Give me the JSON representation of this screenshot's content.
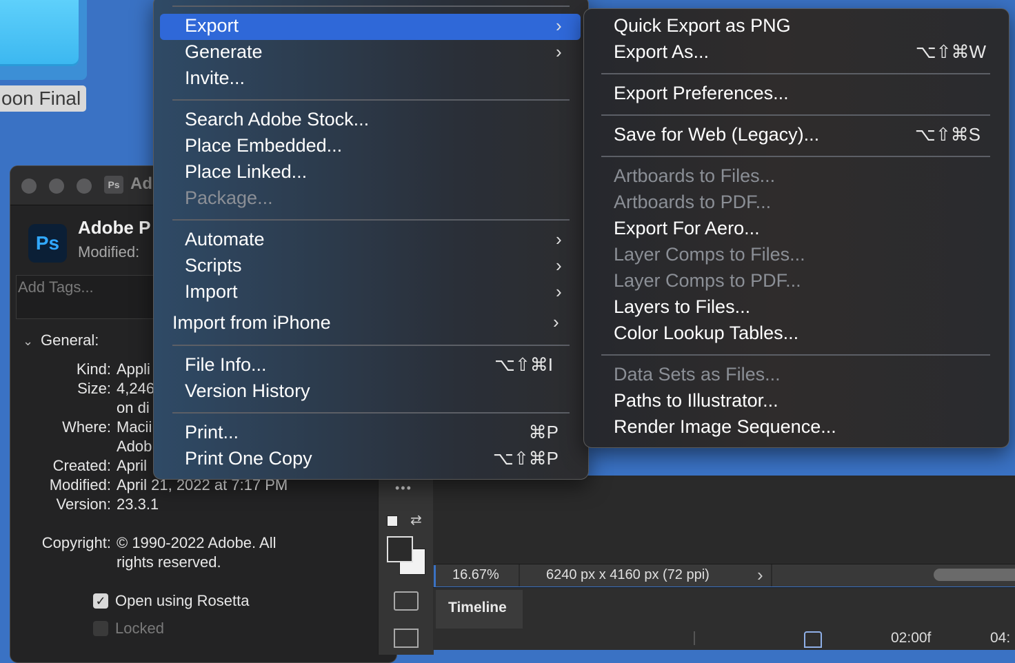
{
  "desktop": {
    "folder_label": "oon Final"
  },
  "info_window": {
    "title": "Ad",
    "ps_small": "Ps",
    "ps_big": "Ps",
    "app_name": "Adobe P",
    "modified_label": "Modified:",
    "tags_placeholder": "Add Tags...",
    "general_label": "General:",
    "rows": [
      {
        "key": "Kind:",
        "value": "Appli"
      },
      {
        "key": "Size:",
        "value": "4,246"
      },
      {
        "key": "",
        "value": "on di"
      },
      {
        "key": "Where:",
        "value": "Macii"
      },
      {
        "key": "",
        "value": "Adob"
      },
      {
        "key": "Created:",
        "value": "April"
      },
      {
        "key": "Modified:",
        "value": "April 21, 2022 at 7:17 PM"
      },
      {
        "key": "Version:",
        "value": "23.3.1"
      },
      {
        "key": "Copyright:",
        "value": "© 1990-2022 Adobe. All"
      },
      {
        "key": "",
        "value": "rights reserved."
      }
    ],
    "open_rosetta": "Open using Rosetta",
    "open_rosetta_checked": true,
    "locked": "Locked",
    "locked_checked": false
  },
  "file_menu": {
    "export": "Export",
    "generate": "Generate",
    "invite": "Invite...",
    "search_stock": "Search Adobe Stock...",
    "place_embedded": "Place Embedded...",
    "place_linked": "Place Linked...",
    "package": "Package...",
    "automate": "Automate",
    "scripts": "Scripts",
    "import": "Import",
    "import_iphone": "Import from iPhone",
    "file_info": "File Info...",
    "file_info_shortcut": "⌥⇧⌘I",
    "version_history": "Version History",
    "print": "Print...",
    "print_shortcut": "⌘P",
    "print_one": "Print One Copy",
    "print_one_shortcut": "⌥⇧⌘P",
    "submenu_arrow": "›"
  },
  "export_menu": {
    "quick_export": "Quick Export as PNG",
    "export_as": "Export As...",
    "export_as_shortcut": "⌥⇧⌘W",
    "export_prefs": "Export Preferences...",
    "save_web": "Save for Web (Legacy)...",
    "save_web_shortcut": "⌥⇧⌘S",
    "artboards_files": "Artboards to Files...",
    "artboards_pdf": "Artboards to PDF...",
    "export_aero": "Export For Aero...",
    "layer_comps_files": "Layer Comps to Files...",
    "layer_comps_pdf": "Layer Comps to PDF...",
    "layers_files": "Layers to Files...",
    "color_lookup": "Color Lookup Tables...",
    "data_sets": "Data Sets as Files...",
    "paths_illustrator": "Paths to Illustrator...",
    "render_sequence": "Render Image Sequence..."
  },
  "photoshop": {
    "zoom": "16.67%",
    "doc_size": "6240 px x 4160 px (72 ppi)",
    "status_arrow": "›",
    "timeline_tab": "Timeline",
    "time_marker_1": "02:00f",
    "time_marker_2": "04:",
    "more_tools": "•••"
  }
}
